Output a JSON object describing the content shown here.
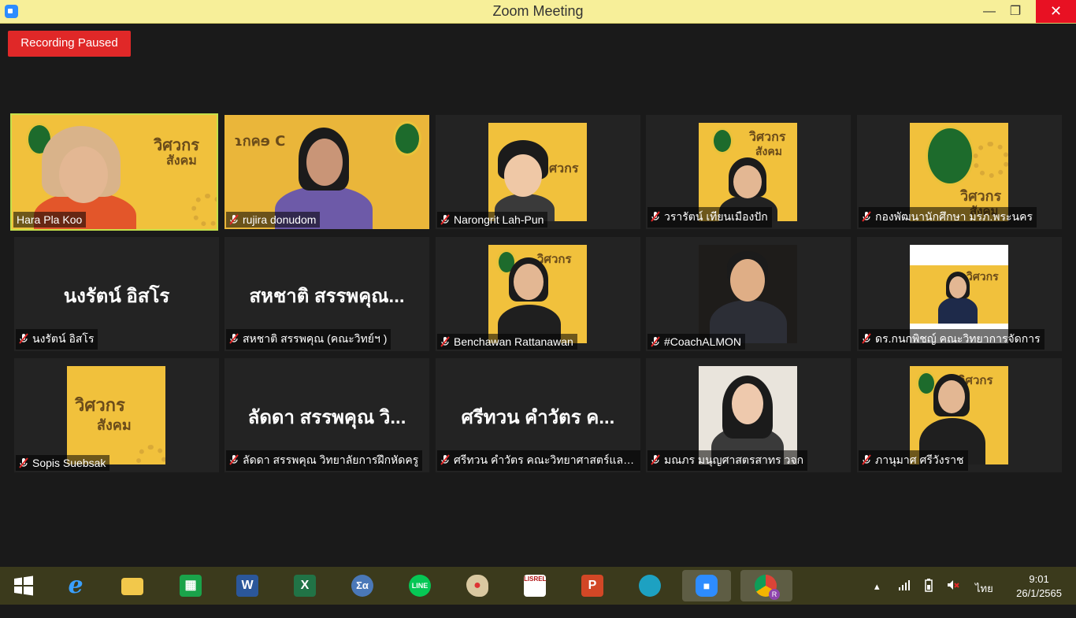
{
  "window": {
    "title": "Zoom Meeting",
    "minimize_glyph": "—",
    "maximize_glyph": "❐",
    "close_glyph": "✕"
  },
  "recording": {
    "label": "Recording Paused"
  },
  "participants": [
    {
      "name": "Hara Pla Koo",
      "muted": false,
      "active": true
    },
    {
      "name": "rujira donudom",
      "muted": true
    },
    {
      "name": "Narongrit Lah-Pun",
      "muted": true
    },
    {
      "name": "วรารัตน์ เทียนเมืองปัก",
      "muted": true
    },
    {
      "name": "กองพัฒนานักศึกษา มรภ.พระนคร",
      "muted": true
    },
    {
      "name": "นงรัตน์ อิสโร",
      "muted": true,
      "display": "นงรัตน์ อิสโร"
    },
    {
      "name": "สหชาติ สรรพคุณ (คณะวิทย์ฯ )",
      "muted": true,
      "display": "สหชาติ สรรพคุณ..."
    },
    {
      "name": "Benchawan Rattanawan",
      "muted": true
    },
    {
      "name": "#CoachALMON",
      "muted": true
    },
    {
      "name": "ดร.กนกพิชญ์ คณะวิทยาการจัดการ",
      "muted": true
    },
    {
      "name": "Sopis Suebsak",
      "muted": true
    },
    {
      "name": "ลัดดา สรรพคุณ วิทยาลัยการฝึกหัดครู",
      "muted": true,
      "display": "ลัดดา สรรพคุณ วิ..."
    },
    {
      "name": "ศรีทวน  คำวัตร คณะวิทยาศาสตร์และเ...",
      "muted": true,
      "display": "ศรีทวน  คำวัตร ค..."
    },
    {
      "name": "มณภร มนุญศาสตรสาทร วจก",
      "muted": true
    },
    {
      "name": "ภานุมาศ ศรีวังราช",
      "muted": true
    }
  ],
  "poster": {
    "title_line1": "วิศวกร",
    "title_line2": "สังคม"
  },
  "taskbar": {
    "apps": [
      "windows-start",
      "internet-explorer",
      "file-explorer",
      "store",
      "word",
      "excel",
      "math-input",
      "line",
      "paint",
      "lisrel",
      "powerpoint",
      "edge",
      "zoom",
      "chrome"
    ],
    "word_letter": "W",
    "excel_letter": "X",
    "line_label": "LINE",
    "ppt_letter": "P",
    "math_label": "Σα",
    "lisrel_label": "LISREL",
    "language": "ไทย",
    "time": "9:01",
    "date": "26/1/2565",
    "chrome_badge": "R"
  },
  "colors": {
    "title_bar": "#f7ef99",
    "recording": "#e02828",
    "active_speaker_border": "#c5e04a",
    "poster_yellow": "#f1c13c",
    "taskbar": "#3b3a1c"
  }
}
